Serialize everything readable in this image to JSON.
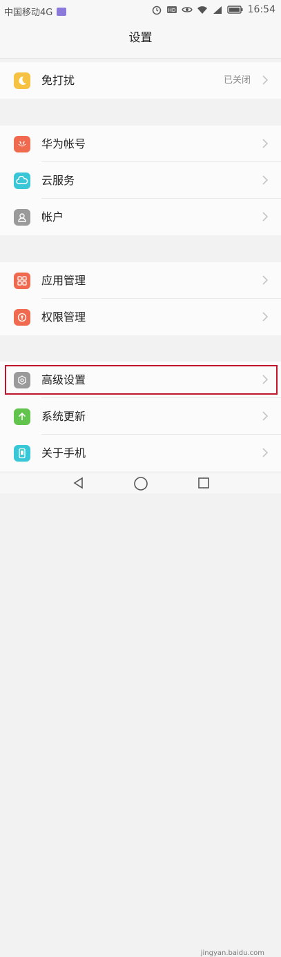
{
  "status_bar": {
    "carrier": "中国移动4G",
    "time": "16:54",
    "icons": [
      "sim-badge-icon",
      "alarm-icon",
      "hd-icon",
      "eye-icon",
      "wifi-icon",
      "signal-4g-icon",
      "battery-icon"
    ]
  },
  "header": {
    "title": "设置"
  },
  "groups": [
    {
      "items": [
        {
          "label": "免打扰",
          "value": "已关闭",
          "icon": "moon-icon",
          "color": "#f6c241"
        }
      ]
    },
    {
      "items": [
        {
          "label": "华为帐号",
          "icon": "huawei-icon",
          "color": "#ef6a4f"
        },
        {
          "label": "云服务",
          "icon": "cloud-icon",
          "color": "#39c6d6"
        },
        {
          "label": "帐户",
          "icon": "person-icon",
          "color": "#9a9a9a"
        }
      ]
    },
    {
      "items": [
        {
          "label": "应用管理",
          "icon": "grid-icon",
          "color": "#ef6a4f"
        },
        {
          "label": "权限管理",
          "icon": "shield-icon",
          "color": "#ef6a4f"
        }
      ]
    },
    {
      "items": [
        {
          "label": "高级设置",
          "icon": "gear-icon",
          "color": "#9a9a9a"
        },
        {
          "label": "系统更新",
          "icon": "arrow-up-icon",
          "color": "#62c44d"
        },
        {
          "label": "关于手机",
          "icon": "phone-icon",
          "color": "#39c6d6"
        }
      ]
    }
  ],
  "nav_bar": {
    "buttons": [
      "back-icon",
      "home-icon",
      "recents-icon"
    ]
  },
  "watermark": "jingyan.baidu.com"
}
